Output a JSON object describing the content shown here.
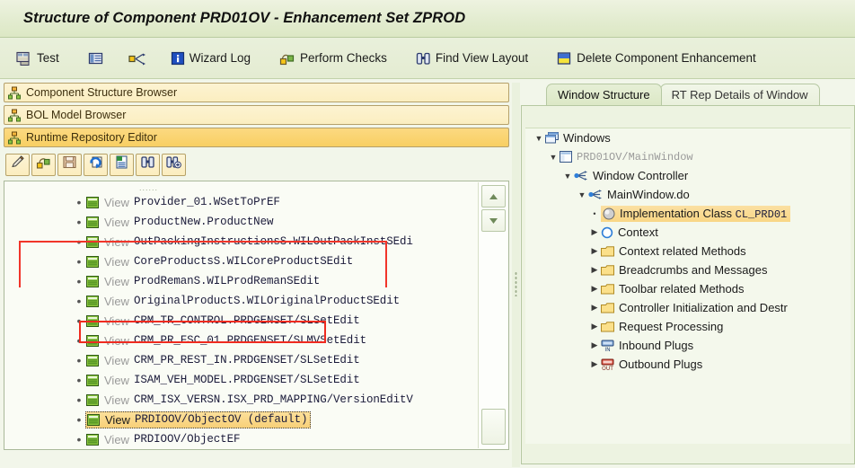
{
  "window": {
    "title": "Structure of Component PRD01OV - Enhancement Set ZPROD"
  },
  "toolbar": {
    "items": [
      {
        "label": "Test",
        "icon": "test-screen-icon"
      },
      {
        "label": "",
        "icon": "list-display-icon"
      },
      {
        "label": "",
        "icon": "navigate-arrows-icon"
      },
      {
        "label": "Wizard Log",
        "icon": "info-icon"
      },
      {
        "label": "Perform Checks",
        "icon": "checks-icon"
      },
      {
        "label": "Find View Layout",
        "icon": "binoculars-icon"
      },
      {
        "label": "Delete Component Enhancement",
        "icon": "delete-enhancement-icon"
      }
    ]
  },
  "left_panel": {
    "nav_buttons": [
      {
        "label": "Component Structure Browser",
        "icon": "hierarchy-icon",
        "active": false
      },
      {
        "label": "BOL Model Browser",
        "icon": "hierarchy-icon",
        "active": false
      },
      {
        "label": "Runtime Repository Editor",
        "icon": "hierarchy-icon",
        "active": true
      }
    ],
    "icon_bar": [
      {
        "icon": "pencil-edit-icon",
        "name": "edit-button"
      },
      {
        "icon": "enhance-component-icon",
        "name": "enhance-button"
      },
      {
        "icon": "save-icon",
        "name": "save-button"
      },
      {
        "icon": "refresh-icon",
        "name": "refresh-button"
      },
      {
        "icon": "document-list-icon",
        "name": "display-button"
      },
      {
        "icon": "binoculars-icon",
        "name": "find-button"
      },
      {
        "icon": "binoculars-plus-icon",
        "name": "find-next-button"
      }
    ],
    "tree": {
      "keyword": "View",
      "rows": [
        {
          "keyword": "View",
          "name": "Provider_01.WSetToPrEF",
          "selected": false
        },
        {
          "keyword": "View",
          "name": "ProductNew.ProductNew",
          "selected": false
        },
        {
          "keyword": "View",
          "name": "OutPackingInstructionsS.WILOutPackInstSEdi",
          "selected": false
        },
        {
          "keyword": "View",
          "name": "CoreProductsS.WILCoreProductSEdit",
          "selected": false
        },
        {
          "keyword": "View",
          "name": "ProdRemanS.WILProdRemanSEdit",
          "selected": false
        },
        {
          "keyword": "View",
          "name": "OriginalProductS.WILOriginalProductSEdit",
          "selected": false
        },
        {
          "keyword": "View",
          "name": "CRM_TR_CONTROL.PRDGENSET/SLSetEdit",
          "selected": false
        },
        {
          "keyword": "View",
          "name": "CRM_PR_FSC_01.PRDGENSET/SLMVSetEdit",
          "selected": false
        },
        {
          "keyword": "View",
          "name": "CRM_PR_REST_IN.PRDGENSET/SLSetEdit",
          "selected": false
        },
        {
          "keyword": "View",
          "name": "ISAM_VEH_MODEL.PRDGENSET/SLSetEdit",
          "selected": false
        },
        {
          "keyword": "View",
          "name": "CRM_ISX_VERSN.ISX_PRD_MAPPING/VersionEditV",
          "selected": false
        },
        {
          "keyword": "View",
          "name": "PRDIOOV/ObjectOV (default)",
          "selected": true
        },
        {
          "keyword": "View",
          "name": "PRDIOOV/ObjectEF",
          "selected": false
        }
      ]
    },
    "scrollbar": {
      "up_arrow": "scroll-up-icon",
      "down_arrow": "scroll-down-icon"
    }
  },
  "right_panel": {
    "tabs": [
      {
        "label": "Window Structure",
        "active": true
      },
      {
        "label": "RT Rep Details of Window",
        "active": false
      }
    ],
    "tree": [
      {
        "indent": 0,
        "twisty": "expanded",
        "icon": "windows-stack-icon",
        "label": "Windows",
        "mono": false,
        "highlighted": false
      },
      {
        "indent": 1,
        "twisty": "expanded",
        "icon": "window-icon",
        "label": "PRD01OV/MainWindow",
        "mono": true,
        "highlighted": false
      },
      {
        "indent": 2,
        "twisty": "expanded",
        "icon": "controller-icon",
        "label": "Window Controller",
        "mono": false,
        "highlighted": false
      },
      {
        "indent": 3,
        "twisty": "expanded",
        "icon": "controller-icon",
        "label": "MainWindow.do",
        "mono": false,
        "highlighted": false
      },
      {
        "indent": 4,
        "twisty": "leaf",
        "icon": "class-sphere-icon",
        "label": "Implementation Class ",
        "label_mono": "CL_PRD01",
        "mono": false,
        "highlighted": true
      },
      {
        "indent": 4,
        "twisty": "collapsed",
        "icon": "context-circle-icon",
        "label": "Context",
        "mono": false,
        "highlighted": false
      },
      {
        "indent": 4,
        "twisty": "collapsed",
        "icon": "folder-icon",
        "label": "Context related Methods",
        "mono": false,
        "highlighted": false
      },
      {
        "indent": 4,
        "twisty": "collapsed",
        "icon": "folder-icon",
        "label": "Breadcrumbs and Messages",
        "mono": false,
        "highlighted": false
      },
      {
        "indent": 4,
        "twisty": "collapsed",
        "icon": "folder-icon",
        "label": "Toolbar related Methods",
        "mono": false,
        "highlighted": false
      },
      {
        "indent": 4,
        "twisty": "collapsed",
        "icon": "folder-icon",
        "label": "Controller Initialization and Destr",
        "mono": false,
        "highlighted": false
      },
      {
        "indent": 4,
        "twisty": "collapsed",
        "icon": "folder-icon",
        "label": "Request Processing",
        "mono": false,
        "highlighted": false
      },
      {
        "indent": 4,
        "twisty": "collapsed",
        "icon": "inbound-plug-icon",
        "label": "Inbound Plugs",
        "mono": false,
        "highlighted": false
      },
      {
        "indent": 4,
        "twisty": "collapsed",
        "icon": "outbound-plug-icon",
        "label": "Outbound Plugs",
        "mono": false,
        "highlighted": false
      }
    ]
  },
  "annotations": {
    "selected_row_box": "red-highlight-box",
    "group_bracket": "red-bracket",
    "color": "#ef2b20"
  }
}
